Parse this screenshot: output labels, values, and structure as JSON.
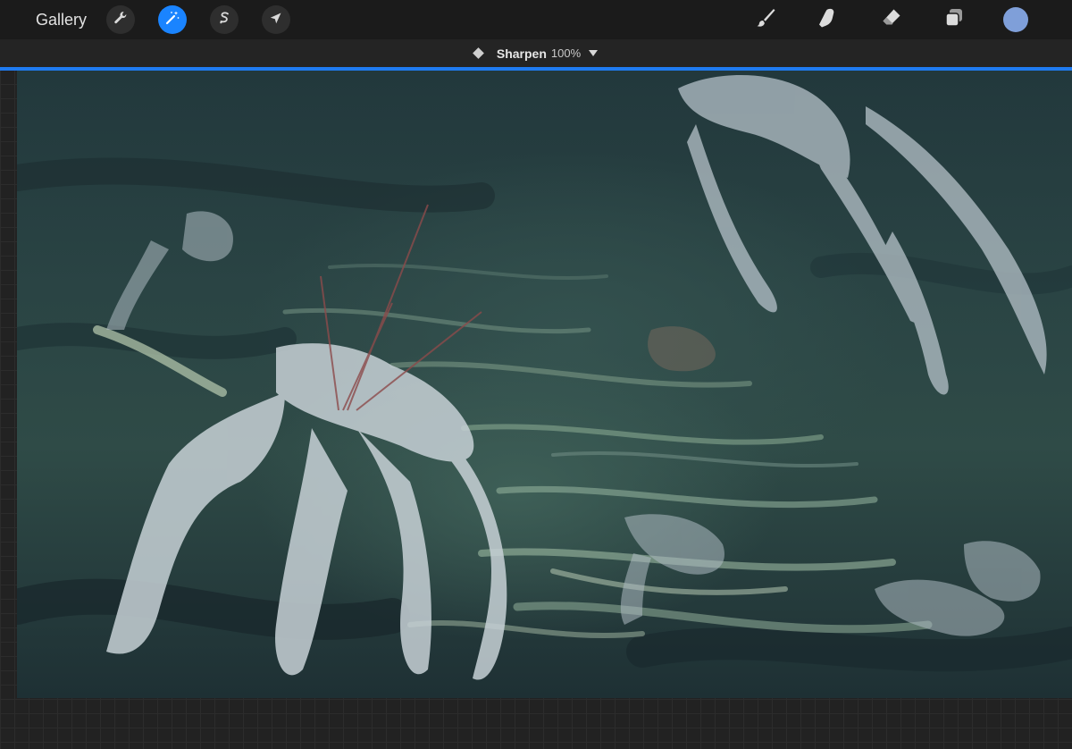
{
  "topbar": {
    "gallery_label": "Gallery",
    "left_tools": [
      {
        "name": "actions",
        "icon": "wrench-icon"
      },
      {
        "name": "adjustments",
        "icon": "magic-wand-icon",
        "active": true
      },
      {
        "name": "selection",
        "icon": "selection-s-icon"
      },
      {
        "name": "transform",
        "icon": "arrow-cursor-icon"
      }
    ],
    "right_tools": [
      {
        "name": "brush",
        "icon": "brush-icon"
      },
      {
        "name": "smudge",
        "icon": "smudge-finger-icon"
      },
      {
        "name": "eraser",
        "icon": "eraser-icon"
      },
      {
        "name": "layers",
        "icon": "layers-icon"
      }
    ],
    "current_color": "#7f9fd9"
  },
  "adjustment": {
    "name": "Sharpen",
    "value": "100%",
    "accent_color": "#1f7bf0"
  },
  "canvas": {
    "subject": "painting"
  }
}
